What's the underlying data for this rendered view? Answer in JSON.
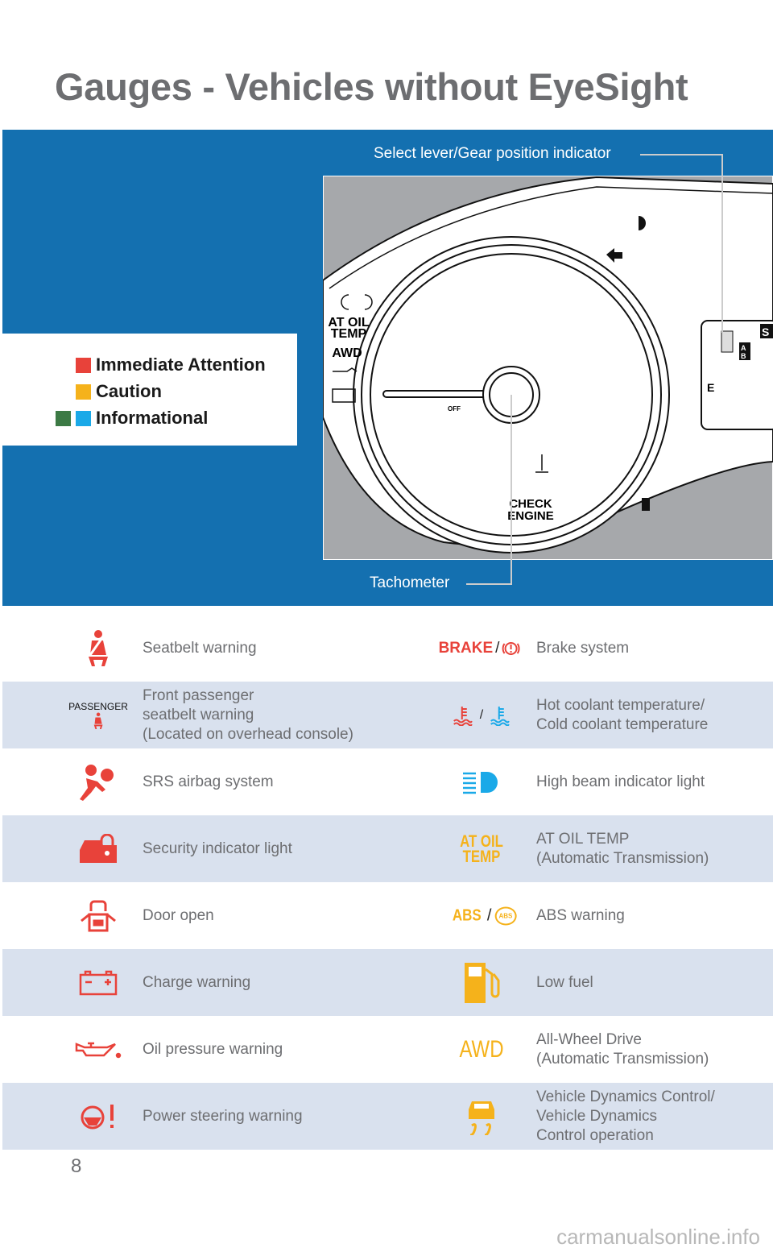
{
  "title": "Gauges - Vehicles without EyeSight",
  "legend": {
    "items": [
      {
        "label": "Immediate Attention",
        "colors": [
          "#e8423a"
        ]
      },
      {
        "label": "Caution",
        "colors": [
          "#f5b21b"
        ]
      },
      {
        "label": "Informational",
        "colors": [
          "#3c7a45",
          "#1aa9e8"
        ]
      }
    ]
  },
  "callouts": {
    "gear": "Select lever/Gear position indicator",
    "tach": "Tachometer"
  },
  "gauge_labels": {
    "at_oil": "AT OIL",
    "temp": "TEMP",
    "awd": "AWD",
    "check": "CHECK",
    "engine": "ENGINE",
    "off": "OFF",
    "e": "E",
    "s": "S",
    "a": "A",
    "b": "B"
  },
  "colors": {
    "panel": "#1470b0",
    "row_alt": "#d9e1ee",
    "red": "#e8423a",
    "yellow": "#f5b21b",
    "blue": "#1aa9e8",
    "text": "#6d6e71"
  },
  "rows": [
    {
      "left": {
        "icon": "seatbelt-icon",
        "color": "#e8423a",
        "label": "Seatbelt warning"
      },
      "right": {
        "icon": "brake-icon",
        "text": "BRAKE",
        "sep": "/",
        "color": "#e8423a",
        "label": "Brake system"
      }
    },
    {
      "left": {
        "icon": "passenger-seatbelt-icon",
        "text": "PASSENGER",
        "color": "#e8423a",
        "label": "Front passenger\nseatbelt warning\n(Located on overhead console)"
      },
      "right": {
        "icon": "coolant-temperature-icon",
        "sep": "/",
        "label": "Hot coolant temperature/\nCold coolant temperature"
      }
    },
    {
      "left": {
        "icon": "airbag-icon",
        "color": "#e8423a",
        "label": "SRS airbag system"
      },
      "right": {
        "icon": "high-beam-icon",
        "color": "#1aa9e8",
        "label": "High beam indicator light"
      }
    },
    {
      "left": {
        "icon": "security-icon",
        "color": "#e8423a",
        "label": "Security indicator light"
      },
      "right": {
        "icon": "at-oil-temp-icon",
        "text": "AT OIL\nTEMP",
        "color": "#f5b21b",
        "label": "AT OIL TEMP\n(Automatic Transmission)"
      }
    },
    {
      "left": {
        "icon": "door-open-icon",
        "color": "#e8423a",
        "label": "Door open"
      },
      "right": {
        "icon": "abs-icon",
        "text": "ABS",
        "badge": "ABS",
        "sep": "/",
        "color": "#f5b21b",
        "label": "ABS warning"
      }
    },
    {
      "left": {
        "icon": "battery-icon",
        "color": "#e8423a",
        "label": "Charge warning"
      },
      "right": {
        "icon": "fuel-icon",
        "color": "#f5b21b",
        "label": "Low fuel"
      }
    },
    {
      "left": {
        "icon": "oil-can-icon",
        "color": "#e8423a",
        "label": "Oil pressure warning"
      },
      "right": {
        "icon": "awd-icon",
        "text": "AWD",
        "color": "#f5b21b",
        "label": "All-Wheel Drive\n(Automatic Transmission)"
      }
    },
    {
      "left": {
        "icon": "power-steering-icon",
        "color": "#e8423a",
        "label": "Power steering warning"
      },
      "right": {
        "icon": "vehicle-dynamics-icon",
        "color": "#f5b21b",
        "label": "Vehicle Dynamics Control/\nVehicle Dynamics\nControl operation"
      }
    }
  ],
  "page_number": "8",
  "watermark": "carmanualsonline.info"
}
